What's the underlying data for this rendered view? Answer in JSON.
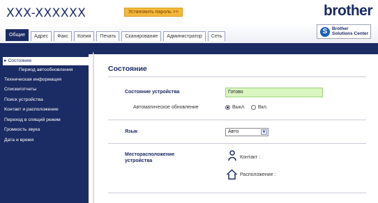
{
  "header": {
    "model": "XXX-XXXXXX",
    "password_button": "Установить пароль >>",
    "logo": "brother"
  },
  "tabs": [
    {
      "label": "Общие",
      "active": true
    },
    {
      "label": "Адрес",
      "active": false
    },
    {
      "label": "Факс",
      "active": false
    },
    {
      "label": "Копия",
      "active": false
    },
    {
      "label": "Печать",
      "active": false
    },
    {
      "label": "Сканирование",
      "active": false
    },
    {
      "label": "Администратор",
      "active": false
    },
    {
      "label": "Сеть",
      "active": false
    }
  ],
  "solutions_center": {
    "line1": "Brother",
    "line2": "Solutions Center",
    "icon": "brother-s-logo-icon"
  },
  "sidebar": {
    "items": [
      {
        "label": "Состояние",
        "active": true,
        "sub": false
      },
      {
        "label": "Период автообновления",
        "active": false,
        "sub": true
      },
      {
        "label": "Техническая информация",
        "active": false,
        "sub": false
      },
      {
        "label": "Списки/отчеты",
        "active": false,
        "sub": false
      },
      {
        "label": "Поиск устройства",
        "active": false,
        "sub": false
      },
      {
        "label": "Контакт и расположение",
        "active": false,
        "sub": false
      },
      {
        "label": "Переход в спящий режим",
        "active": false,
        "sub": false
      },
      {
        "label": "Громкость звука",
        "active": false,
        "sub": false
      },
      {
        "label": "Дата и время",
        "active": false,
        "sub": false
      }
    ]
  },
  "main": {
    "title": "Состояние",
    "device_status_label": "Состояние устройства",
    "device_status_value": "Готово",
    "auto_refresh_label": "Автоматическое обновление",
    "auto_refresh_off": "Выкл.",
    "auto_refresh_on": "Вкл.",
    "auto_refresh_selected": "off",
    "language_label": "Язык",
    "language_value": "Авто",
    "location_label": "Месторасположение устройства",
    "contact_label": "Контакт :",
    "location_value_label": "Расположение :"
  },
  "colors": {
    "brand_navy": "#1b2b63",
    "status_green": "#d9f5c0",
    "password_orange": "#f4b93c"
  }
}
